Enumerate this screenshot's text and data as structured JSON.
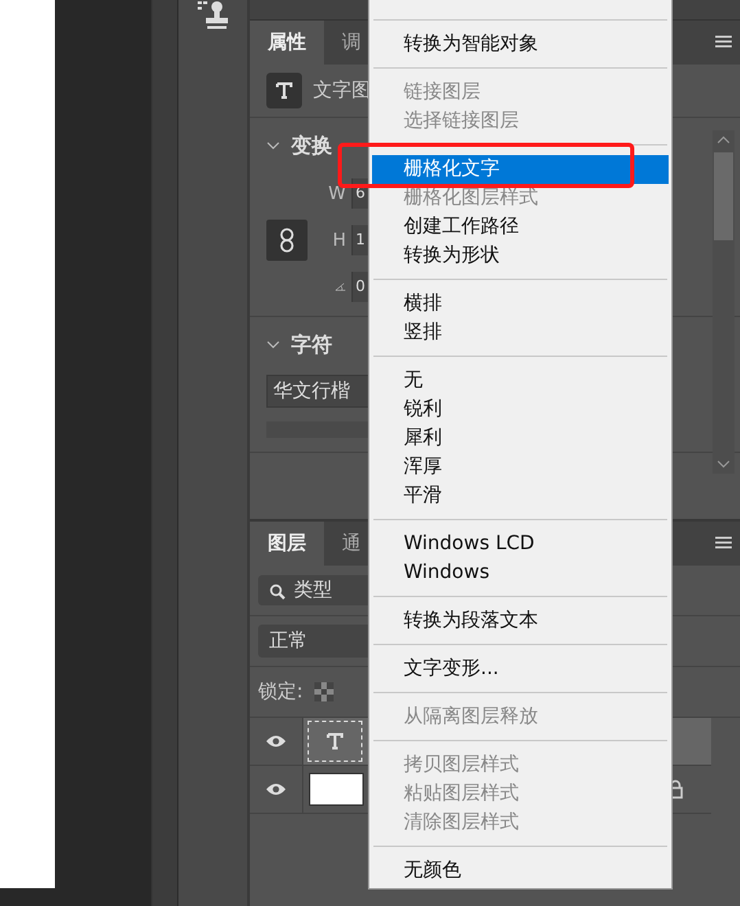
{
  "properties_panel": {
    "tabs": [
      {
        "label": "属性",
        "selected": true
      },
      {
        "label": "调",
        "selected": false
      }
    ],
    "layer_kind": "文字图",
    "transform": {
      "title": "变换",
      "expanded": true,
      "w_label": "W",
      "w_value": "6",
      "h_label": "H",
      "h_value": "1",
      "angle_value": "0"
    },
    "character": {
      "title": "字符",
      "expanded": true,
      "font": "华文行楷"
    }
  },
  "layers_panel": {
    "tabs": [
      {
        "label": "图层",
        "selected": true
      },
      {
        "label": "通",
        "selected": false
      }
    ],
    "filter_placeholder": "类型",
    "blend_mode": "正常",
    "lock_label": "锁定:",
    "layers": [
      {
        "kind": "text",
        "visible": true,
        "selected": true
      },
      {
        "kind": "fill",
        "visible": true,
        "selected": false
      }
    ]
  },
  "context_menu": [
    [
      {
        "label": "转换为智能对象",
        "disabled": false,
        "selected": false
      }
    ],
    [
      {
        "label": "链接图层",
        "disabled": true,
        "selected": false
      },
      {
        "label": "选择链接图层",
        "disabled": true,
        "selected": false
      }
    ],
    [
      {
        "label": "栅格化文字",
        "disabled": false,
        "selected": true
      },
      {
        "label": "栅格化图层样式",
        "disabled": true,
        "selected": false
      },
      {
        "label": "创建工作路径",
        "disabled": false,
        "selected": false
      },
      {
        "label": "转换为形状",
        "disabled": false,
        "selected": false
      }
    ],
    [
      {
        "label": "横排",
        "disabled": false,
        "selected": false
      },
      {
        "label": "竖排",
        "disabled": false,
        "selected": false
      }
    ],
    [
      {
        "label": "无",
        "disabled": false,
        "selected": false
      },
      {
        "label": "锐利",
        "disabled": false,
        "selected": false
      },
      {
        "label": "犀利",
        "disabled": false,
        "selected": false
      },
      {
        "label": "浑厚",
        "disabled": false,
        "selected": false
      },
      {
        "label": "平滑",
        "disabled": false,
        "selected": false
      }
    ],
    [
      {
        "label": "Windows LCD",
        "disabled": false,
        "selected": false
      },
      {
        "label": "Windows",
        "disabled": false,
        "selected": false
      }
    ],
    [
      {
        "label": "转换为段落文本",
        "disabled": false,
        "selected": false
      }
    ],
    [
      {
        "label": "文字变形...",
        "disabled": false,
        "selected": false
      }
    ],
    [
      {
        "label": "从隔离图层释放",
        "disabled": true,
        "selected": false
      }
    ],
    [
      {
        "label": "拷贝图层样式",
        "disabled": true,
        "selected": false
      },
      {
        "label": "粘贴图层样式",
        "disabled": true,
        "selected": false
      },
      {
        "label": "清除图层样式",
        "disabled": true,
        "selected": false
      }
    ],
    [
      {
        "label": "无颜色",
        "disabled": false,
        "selected": false
      }
    ]
  ]
}
